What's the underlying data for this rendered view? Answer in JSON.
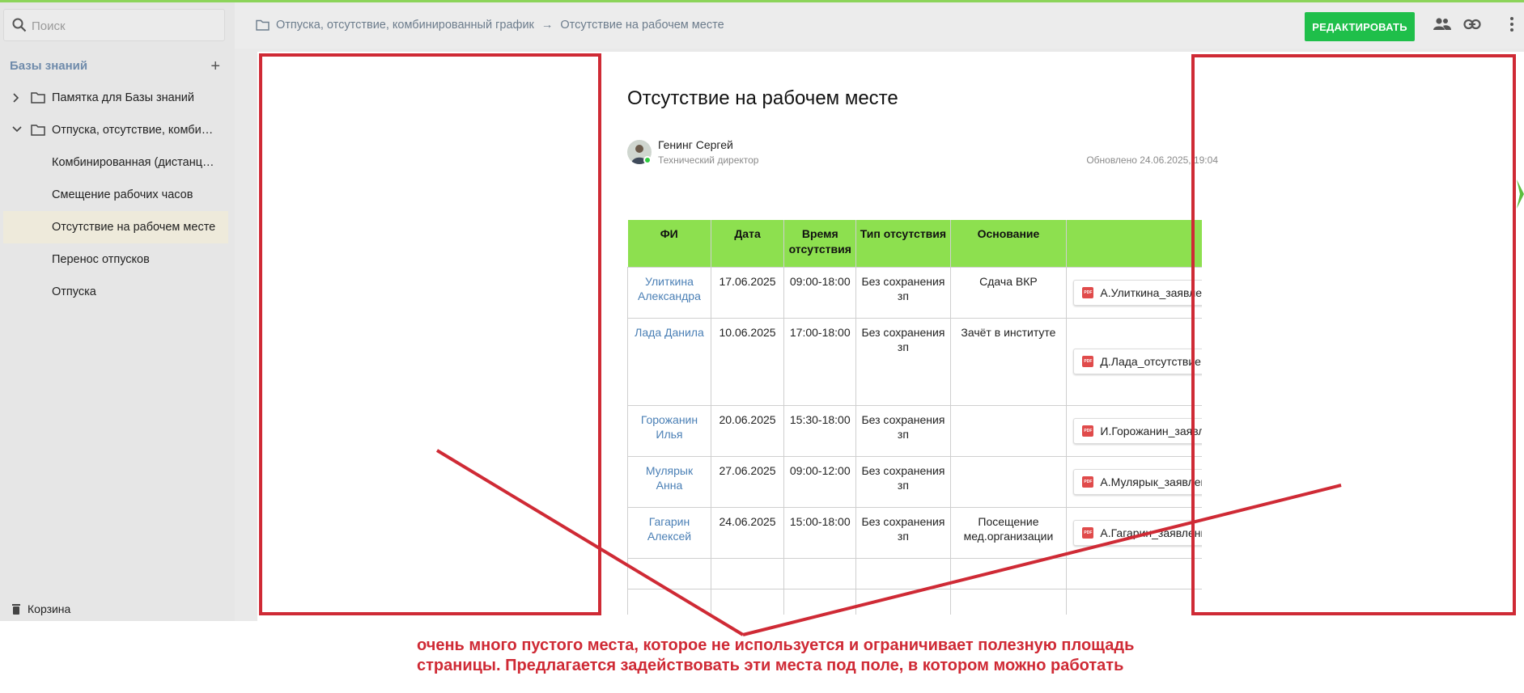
{
  "sidebar": {
    "search_placeholder": "Поиск",
    "section_title": "Базы знаний",
    "add_symbol": "+",
    "items": [
      {
        "label": "Памятка для Базы знаний",
        "type": "folder",
        "expanded": false
      },
      {
        "label": "Отпуска, отсутствие, комбинированный график",
        "type": "folder",
        "expanded": true
      },
      {
        "label": "Комбинированная (дистанционная) работа",
        "type": "page"
      },
      {
        "label": "Смещение рабочих часов",
        "type": "page"
      },
      {
        "label": "Отсутствие на рабочем месте",
        "type": "page",
        "active": true
      },
      {
        "label": "Перенос отпусков",
        "type": "page"
      },
      {
        "label": "Отпуска",
        "type": "page"
      }
    ],
    "trash_label": "Корзина"
  },
  "topbar": {
    "breadcrumb_parent": "Отпуска, отсутствие, комбинированный график",
    "breadcrumb_arrow": "→",
    "breadcrumb_current": "Отсутствие на рабочем месте",
    "edit_button": "РЕДАКТИРОВАТЬ",
    "icons": [
      "users-icon",
      "link-icon",
      "more-vert-icon"
    ]
  },
  "document": {
    "title": "Отсутствие на рабочем месте",
    "author_name": "Генинг Сергей",
    "author_role": "Технический директор",
    "updated": "Обновлено 24.06.2025, 19:04"
  },
  "table": {
    "headers": [
      "ФИ",
      "Дата",
      "Время отсутствия",
      "Тип отсутствия",
      "Основание",
      ""
    ],
    "rows": [
      {
        "name": "Улиткина Александра",
        "date": "17.06.2025",
        "time": "09:00-18:00",
        "type": "Без сохранения зп",
        "reason": "Сдача ВКР",
        "file": "А.Улиткина_заявление.pdf"
      },
      {
        "name": "Лада Данила",
        "date": "10.06.2025",
        "time": "17:00-18:00",
        "type": "Без сохранения зп",
        "reason": "Зачёт в институте",
        "file": "Д.Лада_отсутствие.pdf"
      },
      {
        "name": "Горожанин Илья",
        "date": "20.06.2025",
        "time": "15:30-18:00",
        "type": "Без сохранения зп",
        "reason": "",
        "file": "И.Горожанин_заявление.pdf"
      },
      {
        "name": "Мулярык Анна",
        "date": "27.06.2025",
        "time": "09:00-12:00",
        "type": "Без сохранения зп",
        "reason": "",
        "file": "А.Мулярык_заявление.pdf"
      },
      {
        "name": "Гагарин Алексей",
        "date": "24.06.2025",
        "time": "15:00-18:00",
        "type": "Без сохранения зп",
        "reason": "Посещение мед.организации",
        "file": "А.Гагарин_заявление.pdf"
      }
    ],
    "file_badge": "PDF"
  },
  "annotation": {
    "line1": "очень много пустого места, которое не используется и ограничивает полезную площадь",
    "line2": "страницы. Предлагается задействовать эти места под поле, в котором можно работать",
    "color": "#cf2a35"
  },
  "colors": {
    "accent_green": "#1fbf4a",
    "header_green": "#8de04f",
    "link_blue": "#4a7fb5",
    "sidebar_bg": "#e6e6e6"
  }
}
